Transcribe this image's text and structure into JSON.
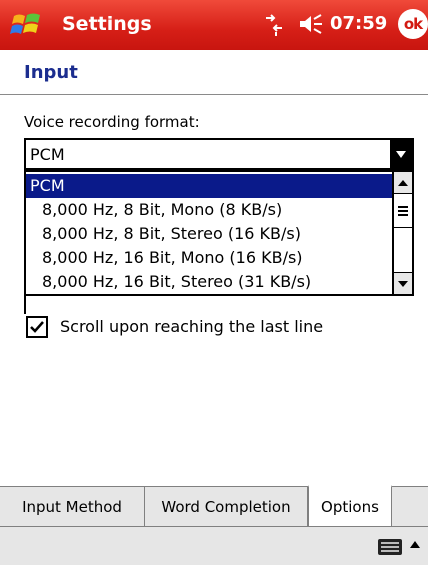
{
  "titlebar": {
    "start_icon": "windows-flag-icon",
    "title": "Settings",
    "connectivity_icon": "connectivity-arrows-icon",
    "volume_icon": "speaker-icon",
    "time": "07:59",
    "ok_label": "ok"
  },
  "page": {
    "title": "Input"
  },
  "voice_format": {
    "label": "Voice recording format:",
    "selected": "PCM",
    "options": [
      "PCM",
      "8,000 Hz, 8 Bit, Mono (8 KB/s)",
      "8,000 Hz, 8 Bit, Stereo (16 KB/s)",
      "8,000 Hz, 16 Bit, Mono (16 KB/s)",
      "8,000 Hz, 16 Bit, Stereo (31 KB/s)"
    ],
    "highlighted_index": 0
  },
  "scroll_option": {
    "label": "Scroll upon reaching the last line",
    "checked": true
  },
  "tabs": [
    {
      "label": "Input Method",
      "active": false
    },
    {
      "label": "Word Completion",
      "active": false
    },
    {
      "label": "Options",
      "active": true
    }
  ],
  "menubar": {
    "keyboard_icon": "keyboard-icon",
    "sip_arrow_icon": "up-arrow-icon"
  },
  "colors": {
    "titlebar": "#d61f17",
    "header_text": "#1b2d8f",
    "selection": "#0a1a8a"
  }
}
